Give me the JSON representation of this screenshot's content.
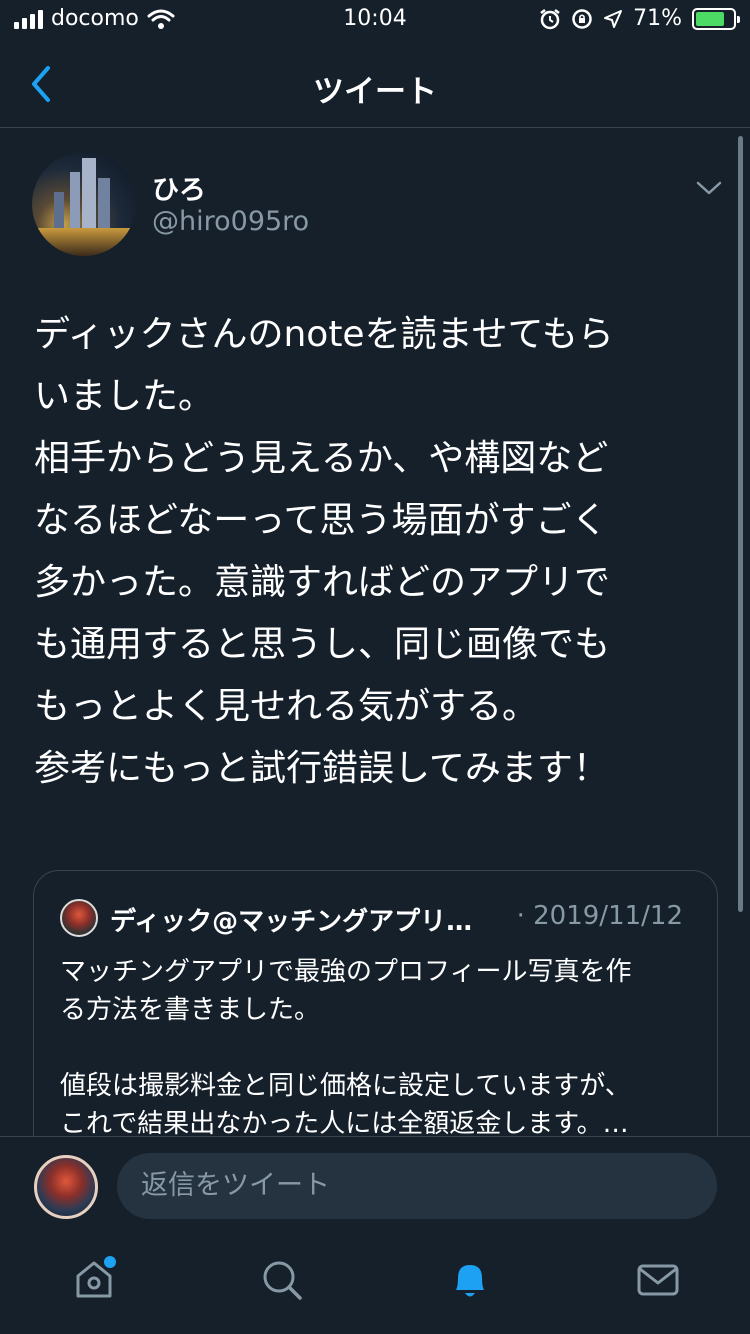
{
  "status_bar": {
    "carrier": "docomo",
    "time": "10:04",
    "battery_percent": "71%"
  },
  "header": {
    "title": "ツイート"
  },
  "tweet": {
    "display_name": "ひろ",
    "handle": "@hiro095ro",
    "text": "ディックさんのnoteを読ませてもら\nいました。\n相手からどう見えるか、や構図など\nなるほどなーって思う場面がすごく\n多かった。意識すればどのアプリで\nも通用すると思うし、同じ画像でも\nもっとよく見せれる気がする。\n参考にもっと試行錯誤してみます！"
  },
  "quote": {
    "author": "ディック@マッチングアプリ…",
    "date": "· 2019/11/12",
    "text": "マッチングアプリで最強のプロフィール写真を作\nる方法を書きました。\n\n値段は撮影料金と同じ価格に設定していますが、\nこれで結果出なかった人には全額返金します。…"
  },
  "reply": {
    "placeholder": "返信をツイート"
  },
  "colors": {
    "background": "#15202b",
    "accent": "#1da1f2",
    "secondary_text": "#8899a6",
    "border": "#38444d"
  },
  "tabs": [
    "home-icon",
    "search-icon",
    "notifications-icon",
    "messages-icon"
  ]
}
